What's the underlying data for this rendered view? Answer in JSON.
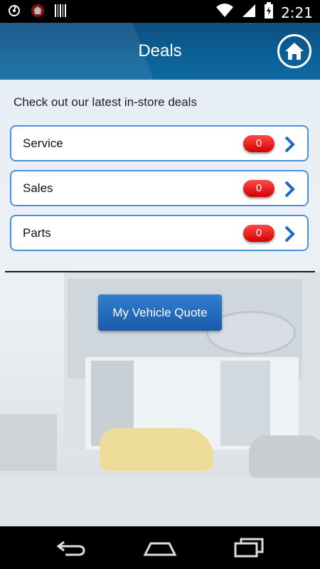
{
  "status_bar": {
    "time": "2:21",
    "left_icons": [
      "sync-icon",
      "app-icon",
      "barcode-icon"
    ],
    "right_icons": [
      "wifi-icon",
      "signal-icon",
      "battery-icon"
    ]
  },
  "header": {
    "title": "Deals",
    "home_icon": "home-icon"
  },
  "intro_text": "Check out our latest in-store deals",
  "deals": [
    {
      "label": "Service",
      "count": "0"
    },
    {
      "label": "Sales",
      "count": "0"
    },
    {
      "label": "Parts",
      "count": "0"
    }
  ],
  "quote_button": {
    "label": "My Vehicle Quote"
  },
  "nav_bar": {
    "icons": [
      "back-icon",
      "home-nav-icon",
      "recents-icon"
    ]
  },
  "colors": {
    "header": "#0b5f95",
    "accent": "#4a90d9",
    "badge": "#d40000",
    "button": "#1c5aa8"
  }
}
